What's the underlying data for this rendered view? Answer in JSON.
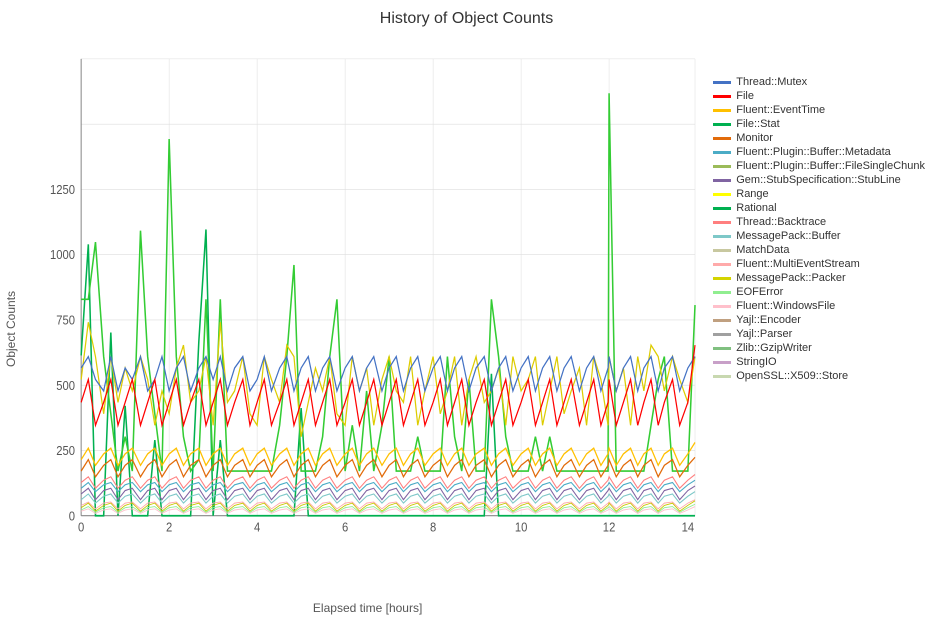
{
  "title": "History of Object Counts",
  "xAxisLabel": "Elapsed time [hours]",
  "yAxisLabel": "Object Counts",
  "yTicks": [
    0,
    250,
    500,
    750,
    1000,
    1250
  ],
  "xTicks": [
    0,
    2,
    4,
    6,
    8,
    10,
    12,
    14
  ],
  "legend": [
    {
      "label": "Thread::Mutex",
      "color": "#4472C4"
    },
    {
      "label": "File",
      "color": "#FF0000"
    },
    {
      "label": "Fluent::EventTime",
      "color": "#FFC000"
    },
    {
      "label": "File::Stat",
      "color": "#00B050"
    },
    {
      "label": "Monitor",
      "color": "#E26B0A"
    },
    {
      "label": "Fluent::Plugin::Buffer::Metadata",
      "color": "#4BACC6"
    },
    {
      "label": "Fluent::Plugin::Buffer::FileSingleChunk",
      "color": "#9BBB59"
    },
    {
      "label": "Gem::StubSpecification::StubLine",
      "color": "#8064A2"
    },
    {
      "label": "Range",
      "color": "#FFFF00"
    },
    {
      "label": "Rational",
      "color": "#00B050"
    },
    {
      "label": "Thread::Backtrace",
      "color": "#FF7F7F"
    },
    {
      "label": "MessagePack::Buffer",
      "color": "#7EC8C8"
    },
    {
      "label": "MatchData",
      "color": "#C8C8A0"
    },
    {
      "label": "Fluent::MultiEventStream",
      "color": "#FFAAAA"
    },
    {
      "label": "MessagePack::Packer",
      "color": "#D4D400"
    },
    {
      "label": "EOFError",
      "color": "#90EE90"
    },
    {
      "label": "Fluent::WindowsFile",
      "color": "#FFC0CB"
    },
    {
      "label": "Yajl::Encoder",
      "color": "#C0A080"
    },
    {
      "label": "Yajl::Parser",
      "color": "#A0A0A0"
    },
    {
      "label": "Zlib::GzipWriter",
      "color": "#80C080"
    },
    {
      "label": "StringIO",
      "color": "#C8A0C8"
    },
    {
      "label": "OpenSSL::X509::Store",
      "color": "#C8D8B0"
    }
  ]
}
